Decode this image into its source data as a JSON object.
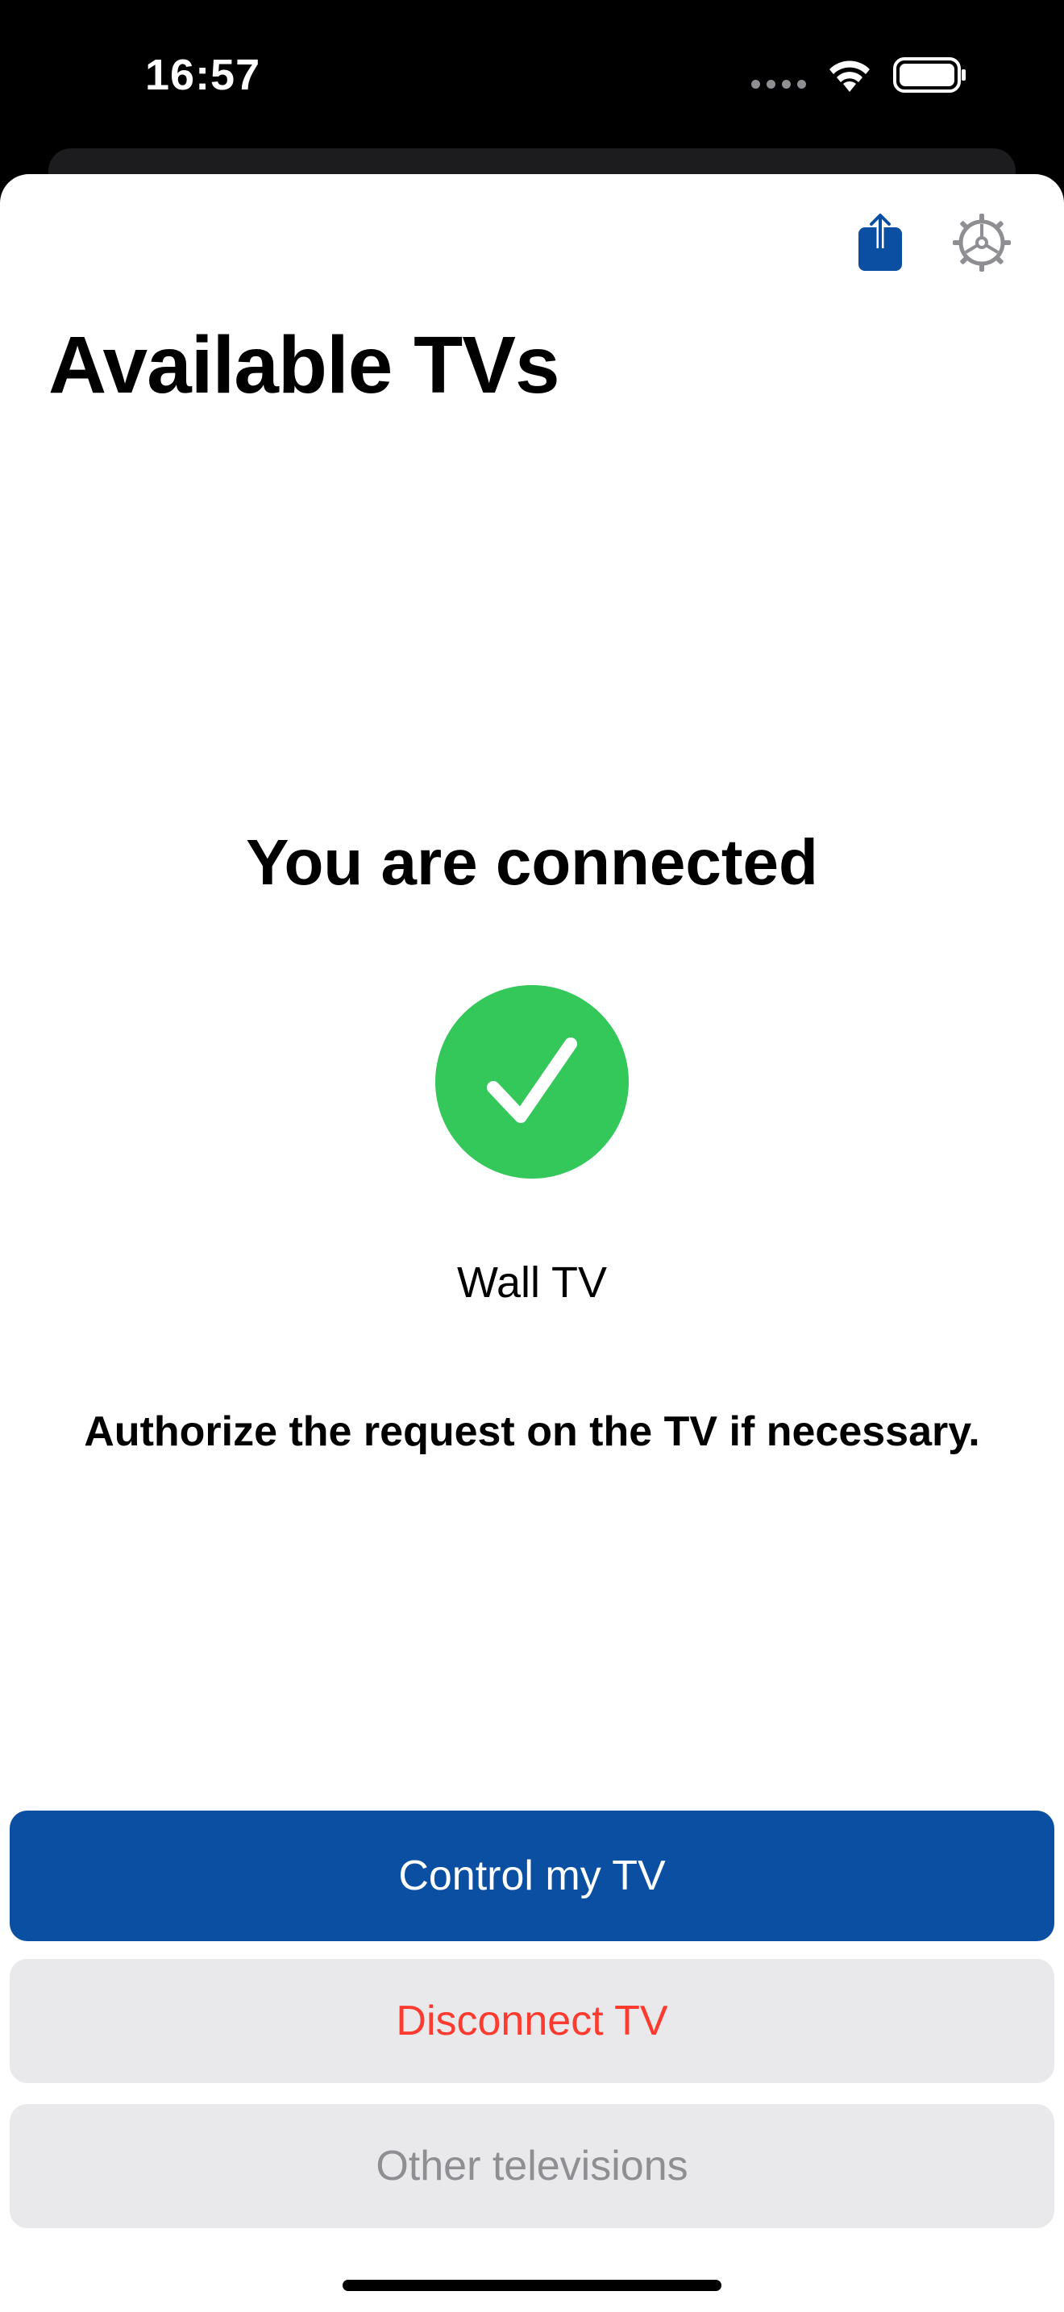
{
  "status_bar": {
    "time": "16:57"
  },
  "colors": {
    "accent": "#0b4fa3",
    "success": "#34c759",
    "danger": "#ff3b30",
    "secondary_text": "#8e8e93",
    "button_gray": "#e9e9eb"
  },
  "toolbar": {
    "share_icon": "share-icon",
    "settings_icon": "gear-icon"
  },
  "header": {
    "title": "Available TVs"
  },
  "status": {
    "title": "You are connected",
    "icon": "checkmark-circle-icon",
    "device_name": "Wall TV",
    "instruction": "Authorize the request on the TV if necessary."
  },
  "actions": {
    "control_label": "Control my TV",
    "disconnect_label": "Disconnect TV",
    "other_label": "Other televisions"
  }
}
